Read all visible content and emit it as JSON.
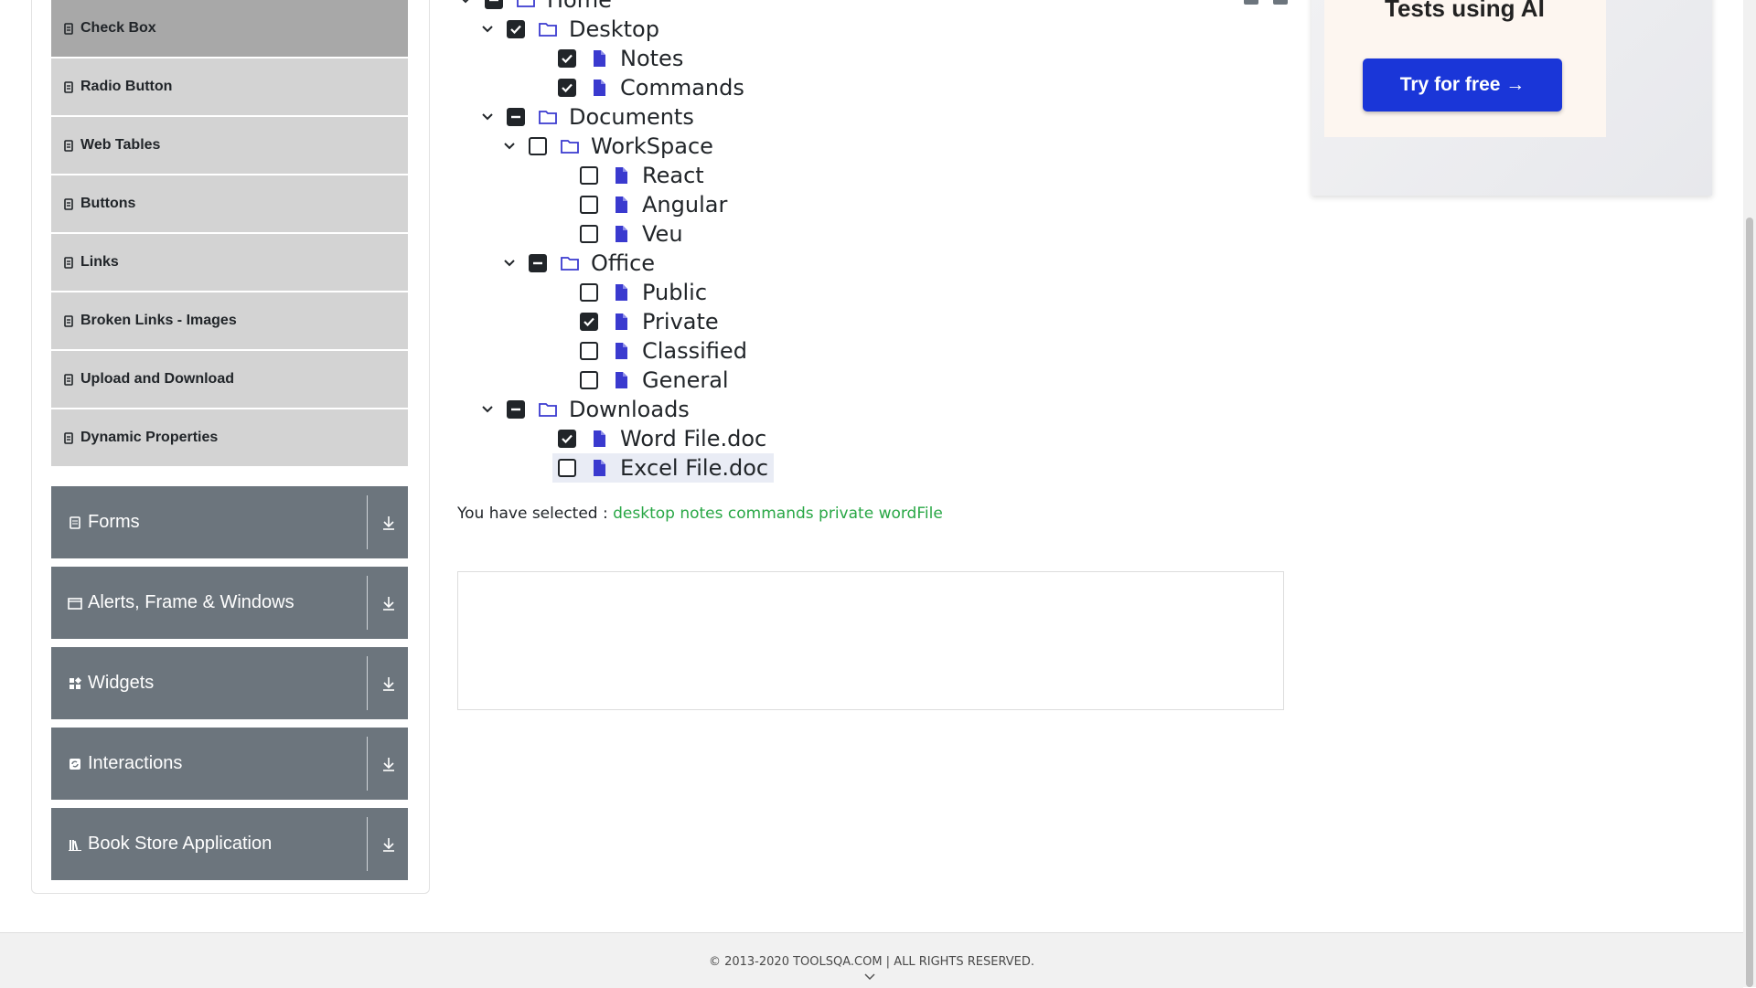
{
  "sidebar": {
    "items": [
      {
        "label": "Check Box",
        "active": true
      },
      {
        "label": "Radio Button",
        "active": false
      },
      {
        "label": "Web Tables",
        "active": false
      },
      {
        "label": "Buttons",
        "active": false
      },
      {
        "label": "Links",
        "active": false
      },
      {
        "label": "Broken Links - Images",
        "active": false
      },
      {
        "label": "Upload and Download",
        "active": false
      },
      {
        "label": "Dynamic Properties",
        "active": false
      }
    ],
    "groups": [
      {
        "label": "Forms",
        "icon": "form-icon"
      },
      {
        "label": "Alerts, Frame & Windows",
        "icon": "window-icon"
      },
      {
        "label": "Widgets",
        "icon": "widgets-icon"
      },
      {
        "label": "Interactions",
        "icon": "interactions-icon"
      },
      {
        "label": "Book Store Application",
        "icon": "library-icon"
      }
    ]
  },
  "tree": {
    "nodes": [
      {
        "label": "Home",
        "type": "folder",
        "state": "partial",
        "expanded": true
      },
      {
        "label": "Desktop",
        "type": "folder",
        "state": "checked",
        "expanded": true
      },
      {
        "label": "Notes",
        "type": "file",
        "state": "checked"
      },
      {
        "label": "Commands",
        "type": "file",
        "state": "checked"
      },
      {
        "label": "Documents",
        "type": "folder",
        "state": "partial",
        "expanded": true
      },
      {
        "label": "WorkSpace",
        "type": "folder",
        "state": "unchecked",
        "expanded": true
      },
      {
        "label": "React",
        "type": "file",
        "state": "unchecked"
      },
      {
        "label": "Angular",
        "type": "file",
        "state": "unchecked"
      },
      {
        "label": "Veu",
        "type": "file",
        "state": "unchecked"
      },
      {
        "label": "Office",
        "type": "folder",
        "state": "partial",
        "expanded": true
      },
      {
        "label": "Public",
        "type": "file",
        "state": "unchecked"
      },
      {
        "label": "Private",
        "type": "file",
        "state": "checked"
      },
      {
        "label": "Classified",
        "type": "file",
        "state": "unchecked"
      },
      {
        "label": "General",
        "type": "file",
        "state": "unchecked"
      },
      {
        "label": "Downloads",
        "type": "folder",
        "state": "partial",
        "expanded": true
      },
      {
        "label": "Word File.doc",
        "type": "file",
        "state": "checked"
      },
      {
        "label": "Excel File.doc",
        "type": "file",
        "state": "unchecked",
        "highlighted": true
      }
    ]
  },
  "result": {
    "prefix": "You have selected :",
    "selected": [
      "desktop",
      "notes",
      "commands",
      "private",
      "wordFile"
    ]
  },
  "promo": {
    "headline": "Tests using AI",
    "button": "Try for free →"
  },
  "footer": {
    "text": "© 2013-2020 TOOLSQA.COM | ALL RIGHTS RESERVED."
  },
  "colors": {
    "accent_blue": "#1a36d8",
    "file_icon": "#3a3acf",
    "selected_green": "#28a745",
    "group_bg": "#6c757d",
    "submenu_bg": "#d3d3d3",
    "submenu_active_bg": "#a8a8a8"
  }
}
